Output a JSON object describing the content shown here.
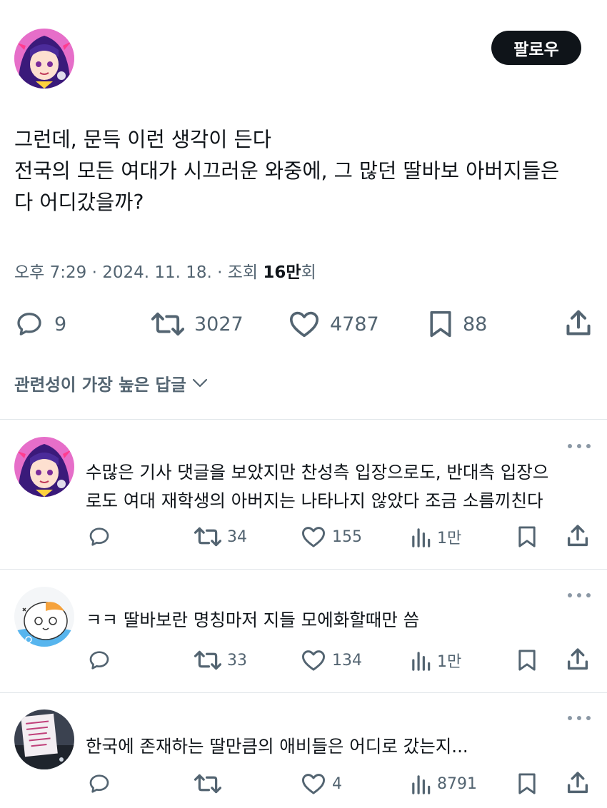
{
  "post": {
    "follow_label": "팔로우",
    "text_lines": [
      "그런데, 문득 이런 생각이 든다",
      "전국의 모든 여대가 시끄러운 와중에, 그 많던 딸바보 아버지들은",
      "다 어디갔을까?"
    ],
    "meta_prefix": "오후 7:29 · 2024. 11. 18. · 조회 ",
    "views_bold": "16만",
    "views_suffix": "회",
    "replies": "9",
    "reposts": "3027",
    "likes": "4787",
    "bookmarks": "88"
  },
  "sort_label": "관련성이 가장 높은 답글",
  "replies": [
    {
      "text_lines": [
        "수많은 기사 댓글을 보았지만 찬성측 입장으로도, 반대측 입장으",
        "로도 여대 재학생의 아버지는 나타나지 않았다 조금 소름끼친다"
      ],
      "reposts": "34",
      "likes": "155",
      "views": "1만"
    },
    {
      "text_lines": [
        "ㅋㅋ 딸바보란 명칭마저 지들 모에화할때만 씀"
      ],
      "reposts": "33",
      "likes": "134",
      "views": "1만"
    },
    {
      "text_lines": [
        "한국에 존재하는 딸만큼의 애비들은 어디로 갔는지..."
      ],
      "reposts": "",
      "likes": "4",
      "views": "8791"
    }
  ],
  "icons": {
    "reply": "speech-bubble-icon",
    "repost": "repost-arrows-icon",
    "like": "heart-icon",
    "views": "bar-chart-icon",
    "bookmark": "bookmark-icon",
    "share": "share-upload-icon",
    "more": "more-dots-icon",
    "sort": "chevron-down-icon"
  },
  "colors": {
    "text": "#0f1419",
    "secondary": "#536471",
    "button": "#0f1419",
    "divider": "#e1e6ea"
  }
}
